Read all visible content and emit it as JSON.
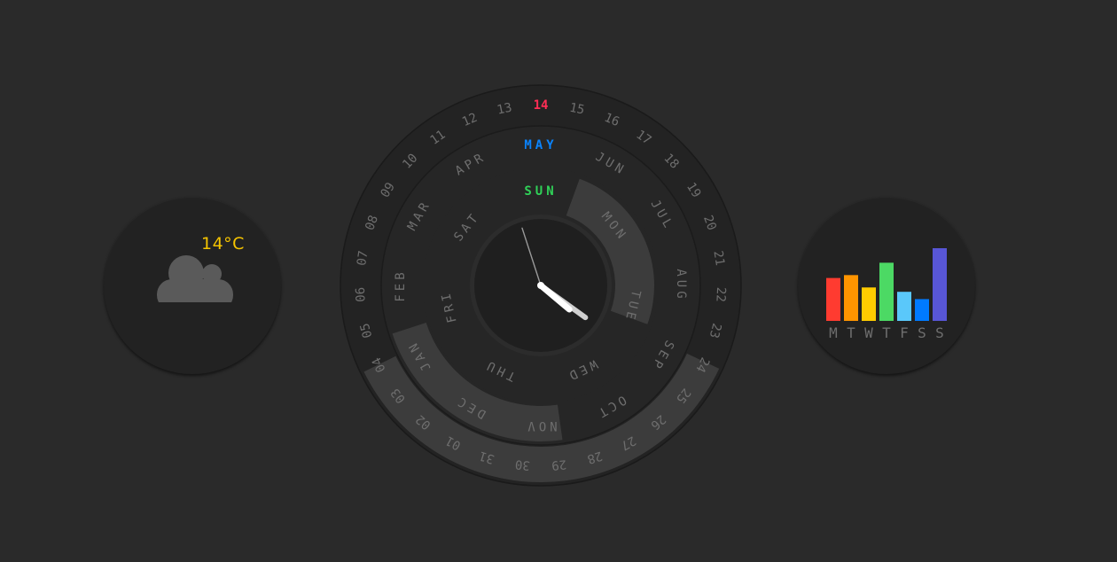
{
  "weather": {
    "temperature": "14°C",
    "temperature_color": "#f5c400",
    "icon": "cloud-icon",
    "icon_color": "#5a5a5a"
  },
  "clock": {
    "days": [
      "01",
      "02",
      "03",
      "04",
      "05",
      "06",
      "07",
      "08",
      "09",
      "10",
      "11",
      "12",
      "13",
      "14",
      "15",
      "16",
      "17",
      "18",
      "19",
      "20",
      "21",
      "22",
      "23",
      "24",
      "25",
      "26",
      "27",
      "28",
      "29",
      "30",
      "31"
    ],
    "current_day": "14",
    "months": [
      "JAN",
      "FEB",
      "MAR",
      "APR",
      "MAY",
      "JUN",
      "JUL",
      "AUG",
      "SEP",
      "OCT",
      "NOV",
      "DEC"
    ],
    "current_month": "MAY",
    "weekdays": [
      "MON",
      "TUE",
      "WED",
      "THU",
      "FRI",
      "SAT",
      "SUN"
    ],
    "current_weekday": "SUN",
    "time": {
      "hour": 4,
      "minute": 20,
      "second": 57
    },
    "colors": {
      "current_day": "#ff2d55",
      "current_month": "#0a84ff",
      "current_weekday": "#30d158",
      "label": "#6e6e6e",
      "hands": "#ffffff",
      "minute_hand": "#d0d0d0",
      "second_hand": "#9a9a9a",
      "progress": "#3c3c3c"
    }
  },
  "stats": {
    "days": [
      "M",
      "T",
      "W",
      "T",
      "F",
      "S",
      "S"
    ],
    "values": [
      0.59,
      0.63,
      0.46,
      0.8,
      0.4,
      0.3,
      1.0
    ],
    "colors": [
      "#ff3b30",
      "#ff9500",
      "#ffcc00",
      "#4cd964",
      "#5ac8fa",
      "#007aff",
      "#5856d6"
    ],
    "label_color": "#6e6e6e"
  }
}
